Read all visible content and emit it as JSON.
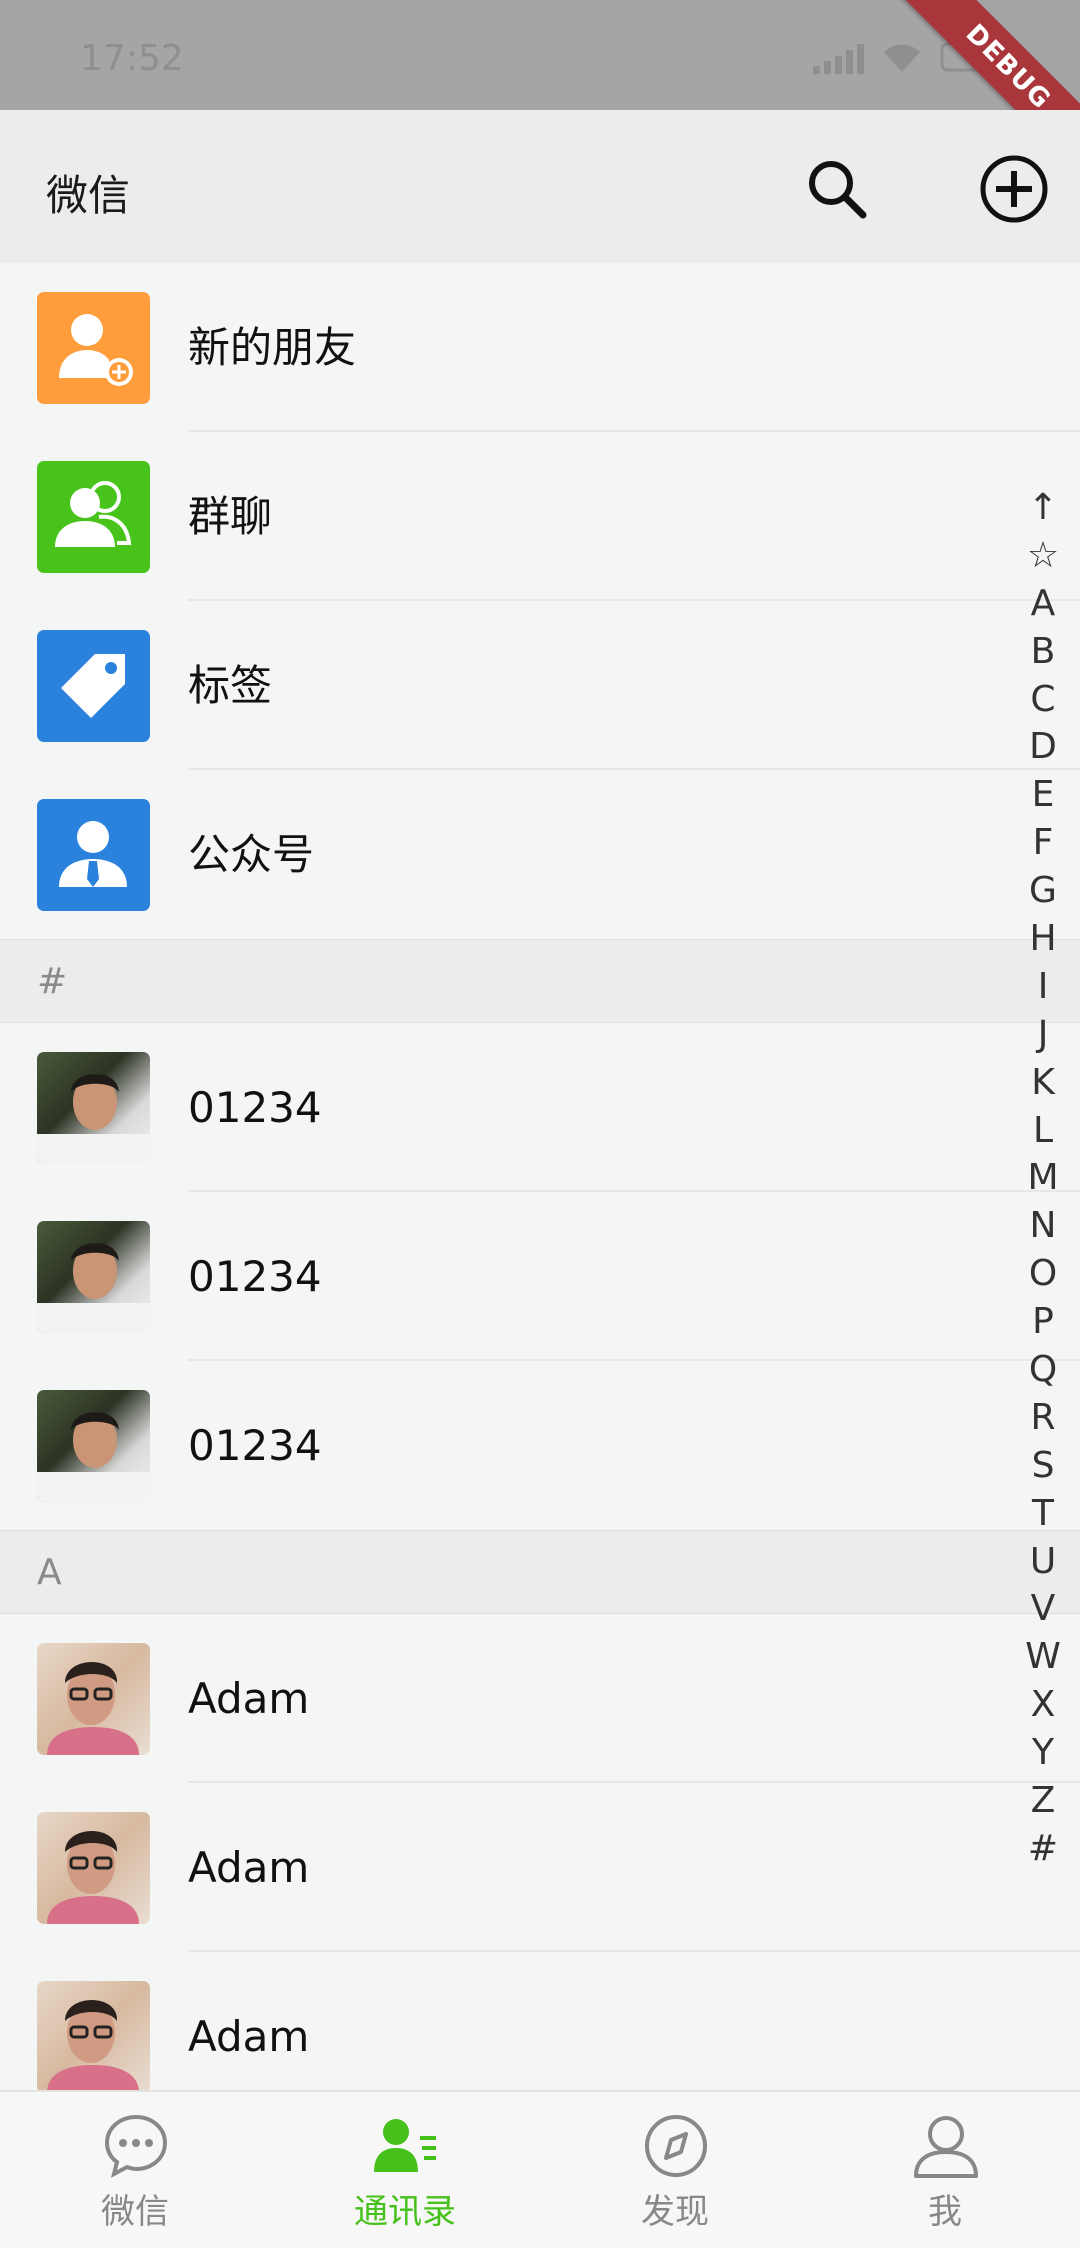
{
  "status_bar": {
    "time": "17:52"
  },
  "debug_ribbon": "DEBUG",
  "app_bar": {
    "title": "微信"
  },
  "contacts_header": [
    {
      "label": "新的朋友",
      "icon": "new-friend-icon",
      "color": "#ff9d3c"
    },
    {
      "label": "群聊",
      "icon": "group-chat-icon",
      "color": "#48c31c"
    },
    {
      "label": "标签",
      "icon": "tag-icon",
      "color": "#2b82dc"
    },
    {
      "label": "公众号",
      "icon": "official-account-icon",
      "color": "#2b82dc"
    }
  ],
  "sections": [
    {
      "header": "#",
      "items": [
        "01234",
        "01234",
        "01234"
      ]
    },
    {
      "header": "A",
      "items": [
        "Adam",
        "Adam",
        "Adam"
      ]
    }
  ],
  "index_bar": [
    "↑",
    "☆",
    "A",
    "B",
    "C",
    "D",
    "E",
    "F",
    "G",
    "H",
    "I",
    "J",
    "K",
    "L",
    "M",
    "N",
    "O",
    "P",
    "Q",
    "R",
    "S",
    "T",
    "U",
    "V",
    "W",
    "X",
    "Y",
    "Z",
    "#"
  ],
  "bottom_nav": [
    {
      "label": "微信",
      "icon": "chat-bubble-icon",
      "active": false
    },
    {
      "label": "通讯录",
      "icon": "contacts-icon",
      "active": true
    },
    {
      "label": "发现",
      "icon": "compass-icon",
      "active": false
    },
    {
      "label": "我",
      "icon": "profile-icon",
      "active": false
    }
  ],
  "colors": {
    "accent": "#46c11b",
    "inactive": "#888888"
  }
}
